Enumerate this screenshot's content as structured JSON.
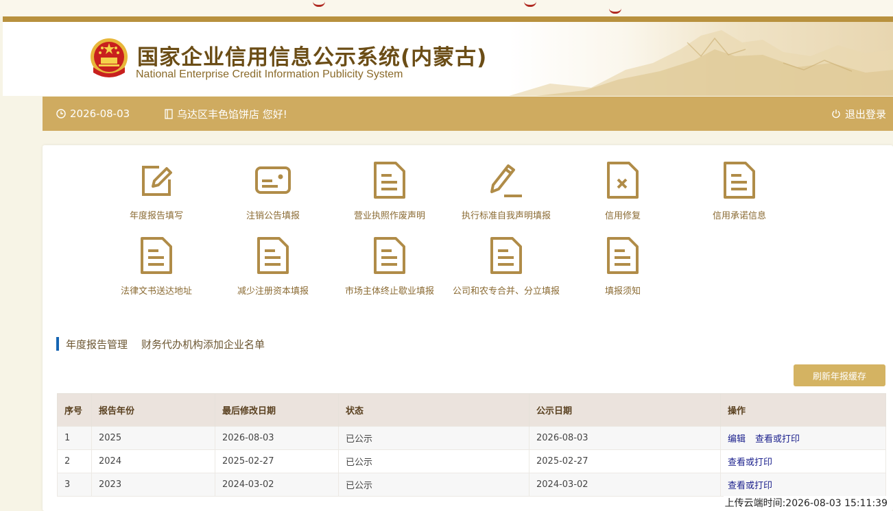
{
  "header": {
    "title": "国家企业信用信息公示系统(内蒙古)",
    "subtitle": "National Enterprise Credit Information Publicity System"
  },
  "navbar": {
    "date": "2026-08-03",
    "greeting": "乌达区丰色馅饼店 您好!",
    "logout": "退出登录"
  },
  "services": [
    {
      "label": "年度报告填写",
      "icon": "edit-icon"
    },
    {
      "label": "注销公告填报",
      "icon": "id-card-icon"
    },
    {
      "label": "营业执照作废声明",
      "icon": "document-icon"
    },
    {
      "label": "执行标准自我声明填报",
      "icon": "pen-icon"
    },
    {
      "label": "信用修复",
      "icon": "document-x-icon"
    },
    {
      "label": "信用承诺信息",
      "icon": "document-icon"
    },
    {
      "label": "法律文书送达地址",
      "icon": "document-icon"
    },
    {
      "label": "减少注册资本填报",
      "icon": "document-icon"
    },
    {
      "label": "市场主体终止歇业填报",
      "icon": "document-icon"
    },
    {
      "label": "公司和农专合并、分立填报",
      "icon": "document-icon"
    },
    {
      "label": "填报须知",
      "icon": "document-icon"
    }
  ],
  "tabs": [
    "年度报告管理",
    "财务代办机构添加企业名单"
  ],
  "refresh_label": "刷新年报缓存",
  "table": {
    "headers": [
      "序号",
      "报告年份",
      "最后修改日期",
      "状态",
      "公示日期",
      "操作"
    ],
    "rows": [
      {
        "no": "1",
        "year": "2025",
        "modified": "2026-08-03",
        "status": "已公示",
        "published": "2026-08-03",
        "actions": [
          "编辑",
          "查看或打印"
        ]
      },
      {
        "no": "2",
        "year": "2024",
        "modified": "2025-02-27",
        "status": "已公示",
        "published": "2025-02-27",
        "actions": [
          "查看或打印"
        ]
      },
      {
        "no": "3",
        "year": "2023",
        "modified": "2024-03-02",
        "status": "已公示",
        "published": "2024-03-02",
        "actions": [
          "查看或打印"
        ]
      }
    ]
  },
  "upload_time": "上传云端时间:2026-08-03 15:11:39",
  "colors": {
    "gold": "#cfab60",
    "icon": "#b08c48",
    "link": "#1a1f8c",
    "accent_bar": "#1665b3"
  }
}
